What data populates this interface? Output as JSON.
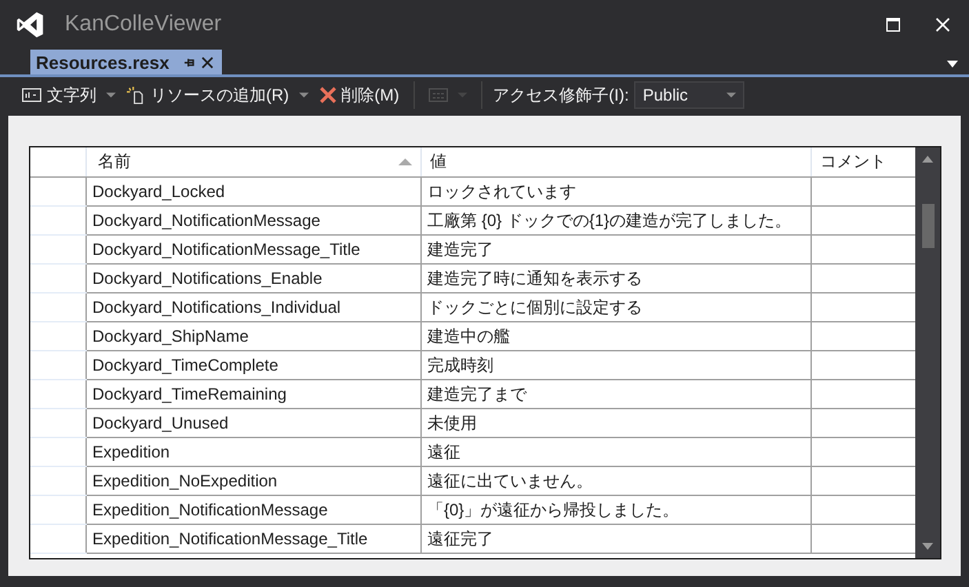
{
  "window": {
    "title": "KanColleViewer"
  },
  "tabs": [
    {
      "label": "Resources.resx",
      "selected": true
    }
  ],
  "toolbar": {
    "items": [
      {
        "kind": "menu",
        "label": "文字列",
        "disabled": false
      },
      {
        "kind": "menu",
        "label": "リソースの追加(R)",
        "disabled": false
      },
      {
        "kind": "button",
        "label": "削除(M)",
        "disabled": false
      },
      {
        "kind": "menu",
        "disabled": true
      }
    ],
    "access_label": "アクセス修飾子(I):",
    "access_value": "Public"
  },
  "table": {
    "columns": [
      {
        "label": "名前",
        "sorted": true
      },
      {
        "label": "値",
        "sorted": false
      },
      {
        "label": "コメント",
        "sorted": false
      }
    ],
    "rows": [
      {
        "name": "Dockyard_Locked",
        "value": "ロックされています"
      },
      {
        "name": "Dockyard_NotificationMessage",
        "value": "工廠第 {0} ドックでの{1}の建造が完了しました。"
      },
      {
        "name": "Dockyard_NotificationMessage_Title",
        "value": "建造完了"
      },
      {
        "name": "Dockyard_Notifications_Enable",
        "value": "建造完了時に通知を表示する"
      },
      {
        "name": "Dockyard_Notifications_Individual",
        "value": "ドックごとに個別に設定する"
      },
      {
        "name": "Dockyard_ShipName",
        "value": "建造中の艦"
      },
      {
        "name": "Dockyard_TimeComplete",
        "value": "完成時刻"
      },
      {
        "name": "Dockyard_TimeRemaining",
        "value": "建造完了まで"
      },
      {
        "name": "Dockyard_Unused",
        "value": "未使用"
      },
      {
        "name": "Expedition",
        "value": "遠征"
      },
      {
        "name": "Expedition_NoExpedition",
        "value": "遠征に出ていません。"
      },
      {
        "name": "Expedition_NotificationMessage",
        "value": "「{0}」が遠征から帰投しました。"
      },
      {
        "name": "Expedition_NotificationMessage_Title",
        "value": "遠征完了"
      }
    ]
  }
}
